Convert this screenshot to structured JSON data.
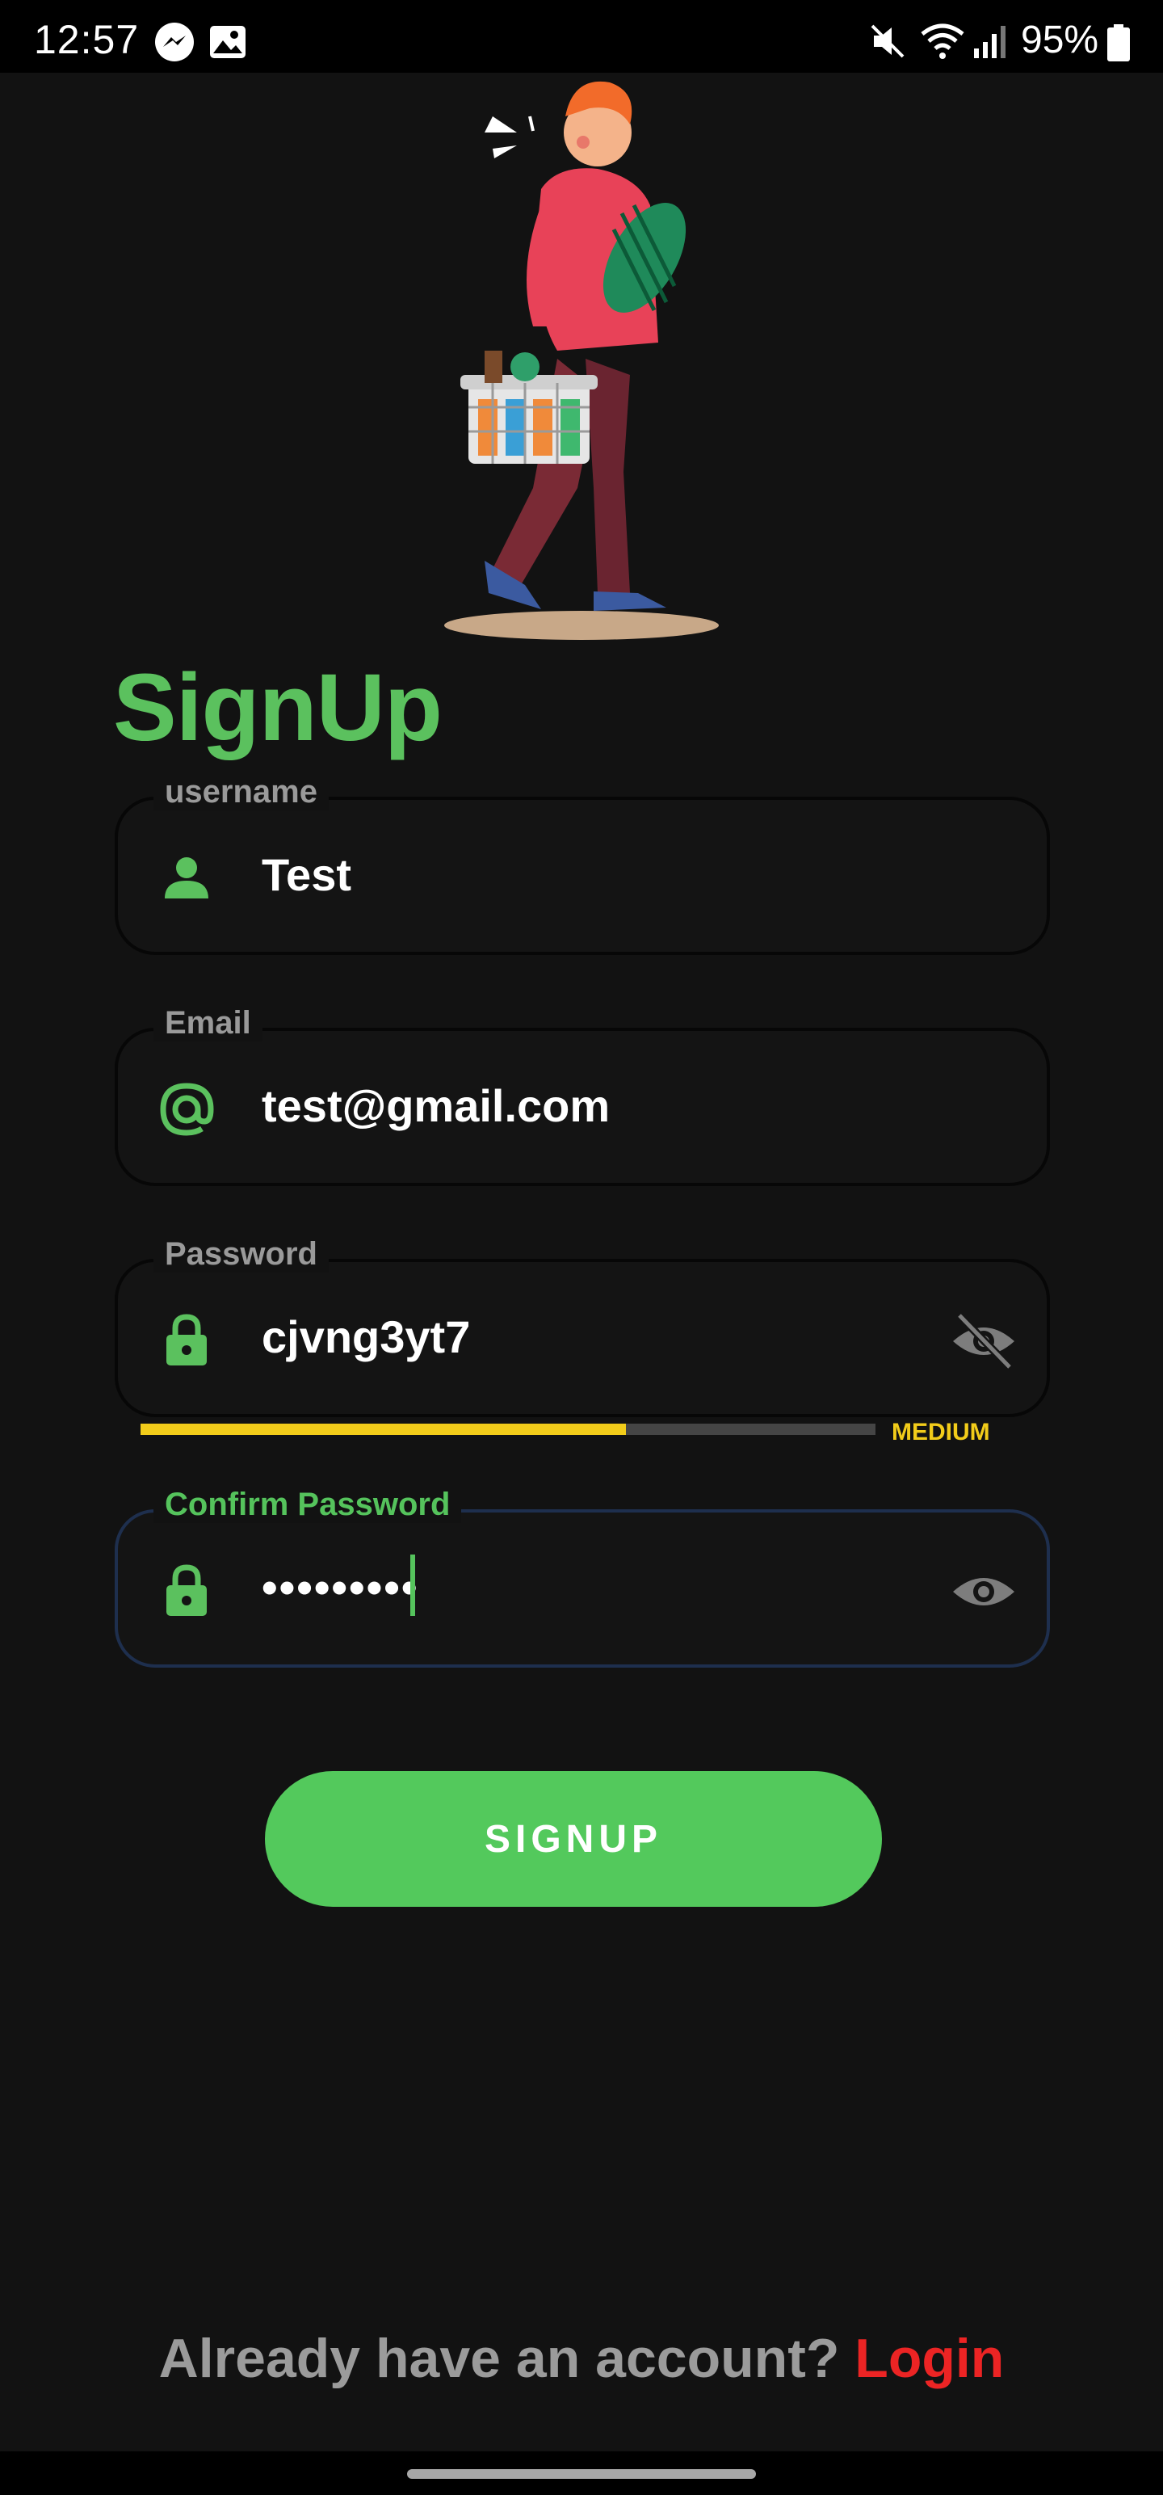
{
  "status_bar": {
    "time": "12:57",
    "battery_percent": "95%",
    "icons": [
      "messenger-icon",
      "gallery-icon",
      "vibrate-icon",
      "wifi-icon",
      "signal-icon",
      "battery-icon"
    ]
  },
  "page": {
    "title": "SignUp"
  },
  "form": {
    "username": {
      "label": "username",
      "value": "Test",
      "icon": "person-icon"
    },
    "email": {
      "label": "Email",
      "value": "test@gmail.com",
      "icon": "at-sign-icon"
    },
    "password": {
      "label": "Password",
      "value": "cjvng3yt7",
      "icon": "lock-icon",
      "toggle_icon": "eye-off-icon"
    },
    "strength": {
      "label": "MEDIUM",
      "level": 0.66,
      "color": "#f2cc1a"
    },
    "confirm_password": {
      "label": "Confirm Password",
      "value": "•••••••••",
      "icon": "lock-icon",
      "toggle_icon": "eye-icon"
    }
  },
  "actions": {
    "signup_label": "SIGNUP"
  },
  "footer": {
    "prompt": "Already have an account? ",
    "login_label": "Login"
  },
  "colors": {
    "accent": "#5bc15e",
    "button": "#53c95c",
    "link": "#ec2424",
    "background": "#121212",
    "focus_border": "#1e2f4e"
  }
}
